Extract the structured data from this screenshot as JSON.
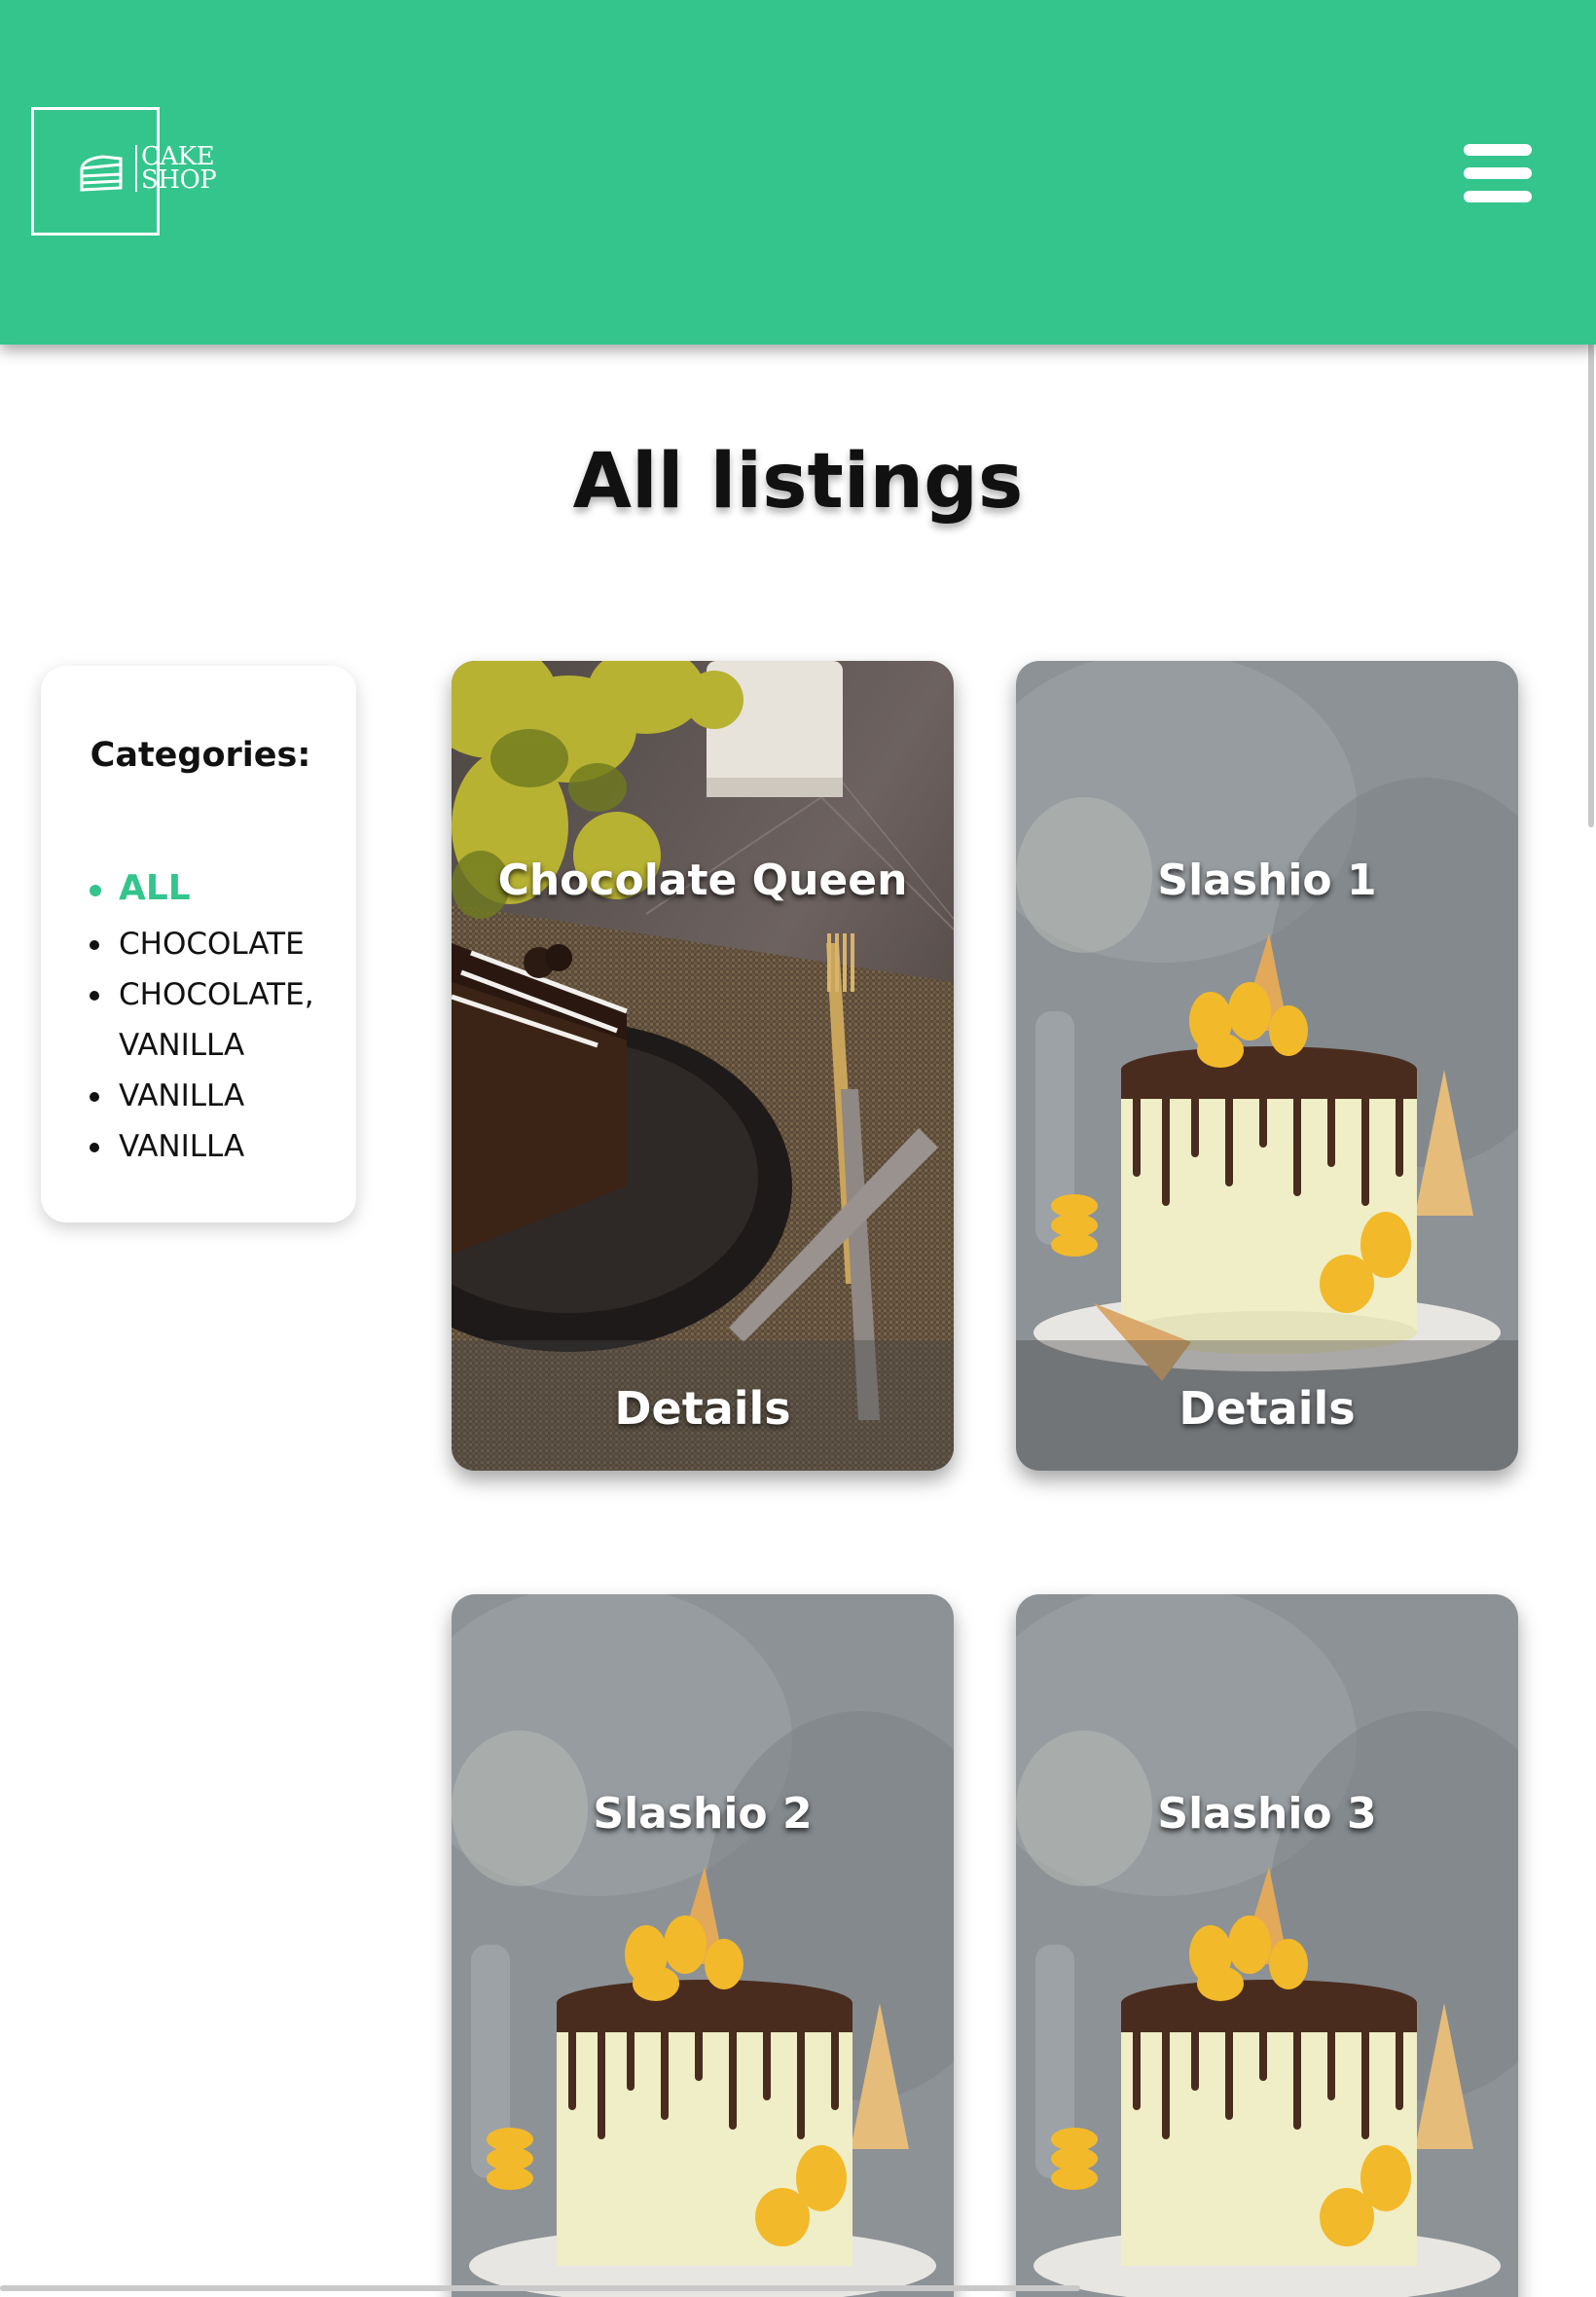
{
  "header": {
    "logo_line1": "CAKE",
    "logo_line2": "SHOP",
    "brand_color": "#33c58c"
  },
  "main": {
    "title": "All listings"
  },
  "categories": {
    "heading": "Categories:",
    "items": [
      {
        "label": "ALL",
        "active": true
      },
      {
        "label": "CHOCOLATE",
        "active": false
      },
      {
        "label": "CHOCOLATE,",
        "active": false
      },
      {
        "label": "VANILLA",
        "active": false
      },
      {
        "label": "VANILLA",
        "active": false
      },
      {
        "label": "VANILLA",
        "active": false
      }
    ]
  },
  "listings": [
    {
      "title": "Chocolate Queen",
      "details_label": "Details",
      "image": "chocolate-cake-slice-photo"
    },
    {
      "title": "Slashio 1",
      "details_label": "Details",
      "image": "drip-cake-photo"
    },
    {
      "title": "Slashio 2",
      "details_label": "",
      "image": "drip-cake-photo"
    },
    {
      "title": "Slashio 3",
      "details_label": "",
      "image": "drip-cake-photo"
    }
  ],
  "icons": {
    "logo": "cake-slice-icon",
    "menu": "hamburger-menu-icon"
  }
}
